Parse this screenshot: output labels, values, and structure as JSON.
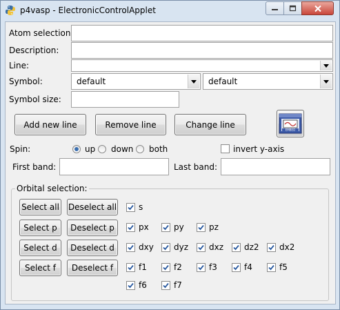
{
  "window": {
    "title": "p4vasp - ElectronicControlApplet"
  },
  "form": {
    "atom_selection_label": "Atom selection:",
    "description_label": "Description:",
    "line_label": "Line:",
    "symbol_label": "Symbol:",
    "symbol_value_1": "default",
    "symbol_value_2": "default",
    "symbol_size_label": "Symbol size:"
  },
  "buttons": {
    "add_new_line": "Add new line",
    "remove_line": "Remove line",
    "change_line": "Change line"
  },
  "spin": {
    "label": "Spin:",
    "options": [
      "up",
      "down",
      "both"
    ],
    "selected": "up",
    "invert_label": "invert y-axis",
    "invert_checked": false
  },
  "bands": {
    "first_label": "First band:",
    "last_label": "Last band:"
  },
  "orbital": {
    "title": "Orbital selection:",
    "rows": [
      {
        "select": "Select all",
        "deselect": "Deselect all",
        "items": [
          [
            "s",
            true
          ]
        ]
      },
      {
        "select": "Select p",
        "deselect": "Deselect p",
        "items": [
          [
            "px",
            true
          ],
          [
            "py",
            true
          ],
          [
            "pz",
            true
          ]
        ]
      },
      {
        "select": "Select d",
        "deselect": "Deselect d",
        "items": [
          [
            "dxy",
            true
          ],
          [
            "dyz",
            true
          ],
          [
            "dxz",
            true
          ],
          [
            "dz2",
            true
          ],
          [
            "dx2",
            true
          ]
        ]
      },
      {
        "select": "Select f",
        "deselect": "Deselect f",
        "items": [
          [
            "f1",
            true
          ],
          [
            "f2",
            true
          ],
          [
            "f3",
            true
          ],
          [
            "f4",
            true
          ],
          [
            "f5",
            true
          ]
        ]
      },
      {
        "select": "",
        "deselect": "",
        "items": [
          [
            "f6",
            true
          ],
          [
            "f7",
            true
          ]
        ]
      }
    ]
  },
  "colors": {
    "accent": "#3b6fb0",
    "close": "#c9463a"
  },
  "icons": [
    "python-icon",
    "minimize-icon",
    "maximize-icon",
    "close-icon",
    "embed-icon",
    "chevron-down-icon",
    "checkmark-icon"
  ]
}
